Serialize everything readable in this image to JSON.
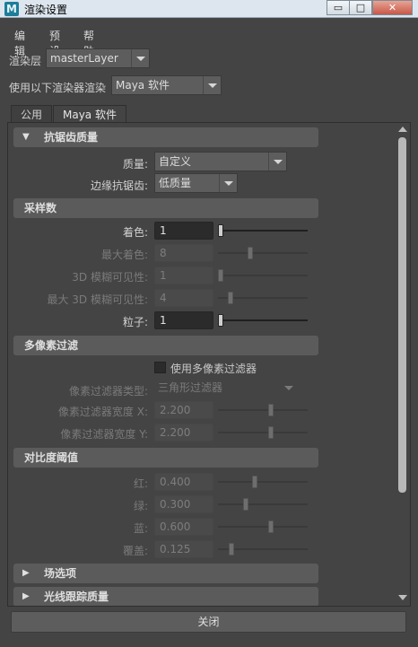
{
  "window": {
    "title": "渲染设置",
    "app_icon_letter": "M",
    "controls": {
      "minimize": "▭",
      "maximize": "□",
      "close": "✕"
    }
  },
  "menu": [
    "编辑",
    "预设",
    "帮助"
  ],
  "render_layer": {
    "label": "渲染层",
    "value": "masterLayer"
  },
  "renderer": {
    "label": "使用以下渲染器渲染",
    "value": "Maya 软件"
  },
  "tabs": [
    {
      "label": "公用",
      "active": false
    },
    {
      "label": "Maya 软件",
      "active": true
    }
  ],
  "antialiasing": {
    "header": "抗锯齿质量",
    "quality_label": "质量:",
    "quality_value": "自定义",
    "edge_label": "边缘抗锯齿:",
    "edge_value": "低质量"
  },
  "sampling": {
    "header": "采样数",
    "rows": [
      {
        "label": "着色:",
        "value": "1",
        "enabled": true,
        "level": 0
      },
      {
        "label": "最大着色:",
        "value": "8",
        "enabled": false,
        "level": 0.35
      },
      {
        "label": "3D 模糊可见性:",
        "value": "1",
        "enabled": false,
        "level": 0
      },
      {
        "label": "最大 3D 模糊可见性:",
        "value": "4",
        "enabled": false,
        "level": 0.12
      },
      {
        "label": "粒子:",
        "value": "1",
        "enabled": true,
        "level": 0
      }
    ]
  },
  "multipixel": {
    "header": "多像素过滤",
    "checkbox_label": "使用多像素过滤器",
    "filter_type_label": "像素过滤器类型:",
    "filter_type_value": "三角形过滤器",
    "rows": [
      {
        "label": "像素过滤器宽度 X:",
        "value": "2.200",
        "level": 0.6
      },
      {
        "label": "像素过滤器宽度 Y:",
        "value": "2.200",
        "level": 0.6
      }
    ]
  },
  "contrast": {
    "header": "对比度阈值",
    "rows": [
      {
        "label": "红:",
        "value": "0.400",
        "level": 0.4
      },
      {
        "label": "绿:",
        "value": "0.300",
        "level": 0.3
      },
      {
        "label": "蓝:",
        "value": "0.600",
        "level": 0.6
      },
      {
        "label": "覆盖:",
        "value": "0.125",
        "level": 0.13
      }
    ]
  },
  "field_options": {
    "header": "场选项"
  },
  "raytracing": {
    "header": "光线跟踪质量"
  },
  "close_button": "关闭"
}
